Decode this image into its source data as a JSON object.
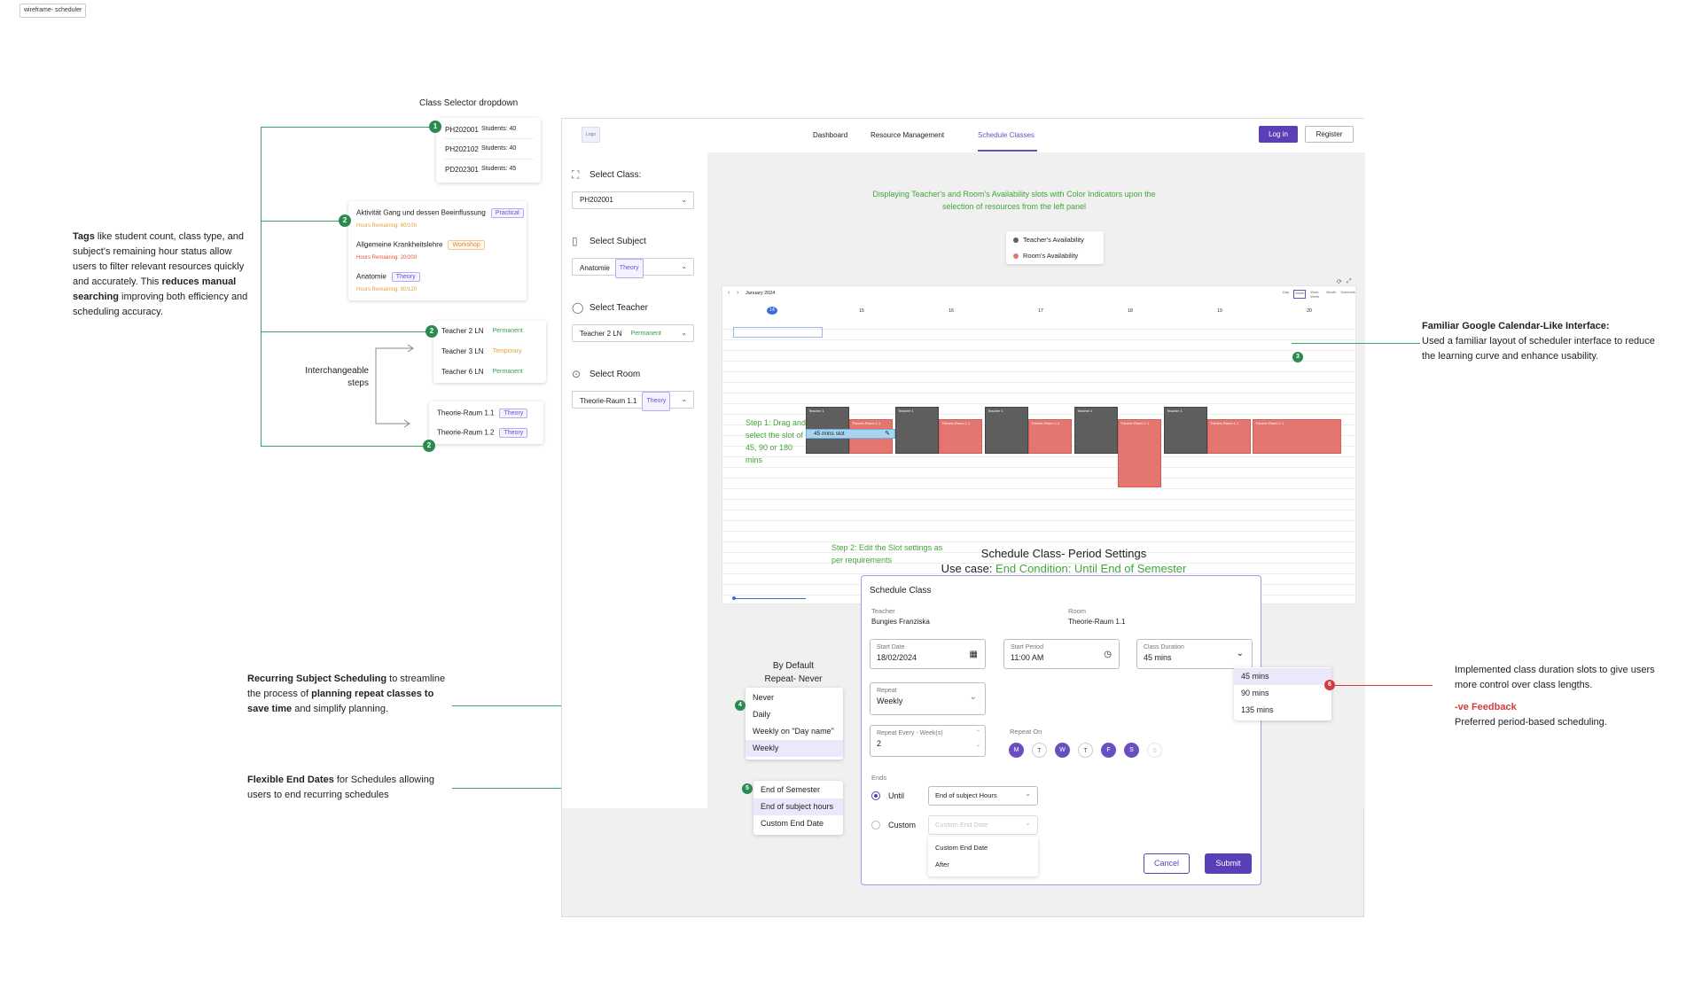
{
  "frame_title": "wireframe- scheduler",
  "annotations": {
    "class_selector_title": "Class Selector dropdown",
    "interchangeable": [
      "Interchangeable",
      "steps"
    ],
    "tags_note": {
      "p1": "Tags",
      "p2": " like student count, class type, and subject's remaining hour status allow users to filter relevant resources quickly and accurately. This ",
      "p3": "reduces manual searching",
      "p4": " improving both efficiency and scheduling accuracy."
    },
    "familiar_note": {
      "title": "Familiar Google Calendar-Like Interface:",
      "body": "Used a familiar layout of scheduler interface to reduce the learning curve and enhance usability."
    },
    "recurring_note": {
      "p1": "Recurring Subject Scheduling",
      "p2": " to streamline the process of ",
      "p3": "planning repeat classes to save time",
      "p4": " and simplify planning."
    },
    "end_dates_note": {
      "p1": "Flexible End Dates",
      "p2": " for Schedules allowing users to end recurring schedules"
    },
    "duration_note": {
      "body": "Implemented class duration slots to give users more control over class lengths.",
      "feedback_title": "-ve Feedback",
      "feedback_body": "Preferred period-based scheduling."
    },
    "default_repeat": [
      "By Default",
      "Repeat- Never"
    ],
    "badges": [
      "1",
      "2",
      "2",
      "2",
      "3",
      "4",
      "5",
      "6"
    ],
    "colors": {
      "accent": "#5b3fb8",
      "green": "#2b8a4f",
      "red": "#d23b3b",
      "teacher": "#5e5e5e",
      "room": "#e5766f"
    }
  },
  "class_dropdown": [
    {
      "code": "PH202001",
      "students": "Students: 40"
    },
    {
      "code": "PH202102",
      "students": "Students: 40"
    },
    {
      "code": "PD202301",
      "students": "Students: 45"
    }
  ],
  "subject_dropdown": [
    {
      "name": "Aktivität Gang und dessen Beeinflussung",
      "tag": "Practical",
      "hours": "Hours Remaining: 60/100"
    },
    {
      "name": "Allgemeine Krankheitslehre",
      "tag": "Workshop",
      "hours": "Hours Remaining: 20/200"
    },
    {
      "name": "Anatomie",
      "tag": "Theory",
      "hours": "Hours Remaining: 80/120"
    }
  ],
  "teacher_dropdown": [
    {
      "name": "Teacher 2 LN",
      "tag": "Permanent"
    },
    {
      "name": "Teacher 3 LN",
      "tag": "Temporary"
    },
    {
      "name": "Teacher 6 LN",
      "tag": "Permanent"
    }
  ],
  "room_dropdown": [
    {
      "name": "Theorie-Raum 1.1",
      "tag": "Theory"
    },
    {
      "name": "Theorie-Raum 1.2",
      "tag": "Theory"
    }
  ],
  "app": {
    "logo": "Logo",
    "nav": [
      "Dashboard",
      "Resource Management",
      "Schedule Classes"
    ],
    "login": "Log in",
    "register": "Register",
    "select_class_label": "Select Class:",
    "select_class_value": "PH202001",
    "select_subject_label": "Select Subject",
    "select_subject_value": "Anatomie",
    "select_subject_tag": "Theory",
    "select_teacher_label": "Select Teacher",
    "select_teacher_value": "Teacher 2 LN",
    "select_teacher_tag": "Permanent",
    "select_room_label": "Select Room",
    "select_room_value": "Theorie-Raum 1.1",
    "select_room_tag": "Theory",
    "banner": [
      "Displaying Teacher's and Room's Availability slots with Color Indicators upon the",
      "selection of resources from the left panel"
    ],
    "legend": [
      "Teacher's Availability",
      "Room's Availability"
    ],
    "calendar_month": "January 2024",
    "view_buttons": [
      "Day",
      "Week",
      "Work Week",
      "Month",
      "Schedule"
    ],
    "day_numbers": [
      "14",
      "15",
      "16",
      "17",
      "18",
      "19",
      "20"
    ],
    "step1": [
      "Step 1: Drag and",
      "select the slot of",
      "45, 90 or 180",
      "mins"
    ],
    "slot_label": "45 mins slot",
    "step2": [
      "Step 2: Edit the Slot settings as",
      "per requirements"
    ],
    "teacher_block": "Teacher 1",
    "room_block": "Theorie-Raum 1.1"
  },
  "period_title": "Schedule Class- Period Settings",
  "use_case_prefix": "Use case: ",
  "use_case_value": "End Condition: Until End of Semester",
  "modal": {
    "title": "Schedule Class",
    "teacher_label": "Teacher",
    "teacher_value": "Bungies Franziska",
    "room_label": "Room",
    "room_value": "Theorie-Raum 1.1",
    "start_date_label": "Start Date",
    "start_date_value": "18/02/2024",
    "start_period_label": "Start Period",
    "start_period_value": "11:00 AM",
    "duration_label": "Class Duration",
    "duration_value": "45 mins",
    "repeat_label": "Repeat",
    "repeat_value": "Weekly",
    "repeat_every_label": "Repeat Every - Week(s)",
    "repeat_every_value": "2",
    "repeat_on_label": "Repeat On",
    "days": [
      "M",
      "T",
      "W",
      "T",
      "F",
      "S",
      "S"
    ],
    "ends_label": "Ends",
    "until_label": "Until",
    "until_value": "End of subject Hours",
    "custom_label": "Custom",
    "custom_placeholder": "Custom End Date",
    "custom_menu": [
      "Custom End Date",
      "After"
    ],
    "cancel": "Cancel",
    "submit": "Submit"
  },
  "duration_menu": [
    "45 mins",
    "90 mins",
    "135 mins"
  ],
  "repeat_menu": [
    "Never",
    "Daily",
    "Weekly on \"Day name\"",
    "Weekly"
  ],
  "ends_menu": [
    "End of Semester",
    "End of subject hours",
    "Custom End Date"
  ]
}
